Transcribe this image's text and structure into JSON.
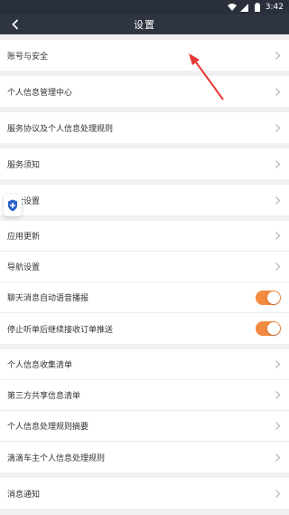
{
  "statusbar": {
    "time": "3:42"
  },
  "navbar": {
    "title": "设置"
  },
  "groups": [
    [
      "账号与安全"
    ],
    [
      "个人信息管理中心"
    ],
    [
      "服务协议及个人信息处理规则"
    ],
    [
      "服务须知"
    ],
    [
      "安全设置"
    ],
    [
      "应用更新",
      "导航设置",
      "聊天消息自动语音播报",
      "停止听单后继续接收订单推送"
    ],
    [
      "个人信息收集清单",
      "第三方共享信息清单",
      "个人信息处理规则摘要",
      "滴滴车主个人信息处理规则"
    ],
    [
      "消息通知"
    ]
  ],
  "toggles": {
    "voice_broadcast": true,
    "continue_push": true
  },
  "colors": {
    "toggle_on": "#f28a3f",
    "navbar": "#2f3441",
    "annotation": "#e53935"
  },
  "icons": {
    "back": "chevron-left",
    "row": "chevron-right",
    "float": "shield"
  }
}
